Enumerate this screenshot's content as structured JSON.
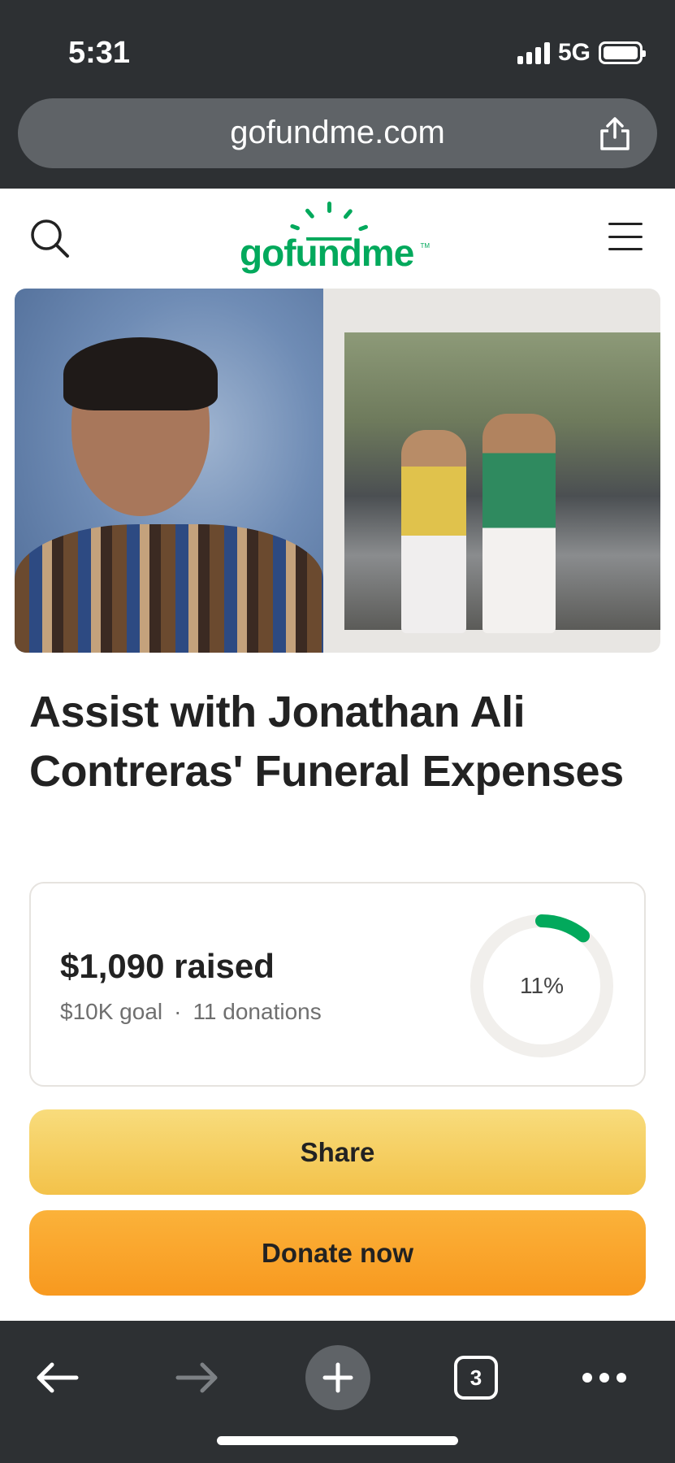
{
  "status_bar": {
    "time": "5:31",
    "network": "5G"
  },
  "browser": {
    "url": "gofundme.com",
    "tab_count": "3"
  },
  "header": {
    "logo_text": "gofundme",
    "logo_tm": "TM"
  },
  "campaign": {
    "title": "Assist with Jonathan Ali Contreras' Funeral Expenses",
    "raised": "$1,090 raised",
    "goal": "$10K goal",
    "separator": "·",
    "donations": "11 donations",
    "progress_percent": 11,
    "progress_label": "11%"
  },
  "actions": {
    "share_label": "Share",
    "donate_label": "Donate now"
  },
  "colors": {
    "brand_green": "#02a95c",
    "share_yellow": "#f5cf5d",
    "donate_orange": "#f9a72b",
    "chrome_dark": "#2d3033"
  },
  "icons": [
    "search-icon",
    "menu-icon",
    "share-icon",
    "back-arrow-icon",
    "forward-arrow-icon",
    "plus-icon",
    "tabs-icon",
    "more-icon"
  ]
}
